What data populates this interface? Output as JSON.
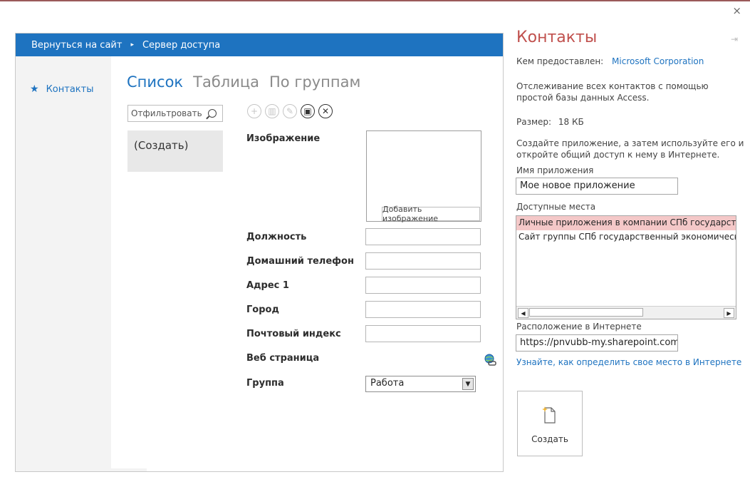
{
  "window": {
    "close_label": "×"
  },
  "preview": {
    "nav_back": "Вернуться на сайт",
    "nav_arrow": "▸",
    "nav_current": "Сервер доступа",
    "sidebar_item": "Контакты",
    "views": [
      "Список",
      "Таблица",
      "По группам"
    ],
    "filter_placeholder": "Отфильтровать",
    "list_item": "(Создать)",
    "fields": {
      "image": "Изображение",
      "add_image": "Добавить изображение",
      "position": "Должность",
      "home_phone": "Домашний телефон",
      "address": "Адрес 1",
      "city": "Город",
      "zip": "Почтовый индекс",
      "web": "Веб страница",
      "group": "Группа",
      "group_value": "Работа"
    },
    "toolbar_icons": [
      "add-icon",
      "delete-icon",
      "edit-icon",
      "save-icon",
      "cancel-icon"
    ]
  },
  "right_panel": {
    "title": "Контакты",
    "provider_label": "Кем предоставлен:",
    "provider_value": "Microsoft Corporation",
    "description": "Отслеживание всех контактов с помощью простой базы данных Access.",
    "size_label": "Размер:",
    "size_value": "18 КБ",
    "create_hint": "Создайте приложение, а затем используйте его и откройте общий доступ к нему в Интернете.",
    "app_name_label": "Имя приложения",
    "app_name_value": "Мое новое приложение",
    "places_label": "Доступные места",
    "places": [
      "Личные приложения в компании СПб государст",
      "Сайт группы СПб государственный экономически"
    ],
    "location_label": "Расположение в Интернете",
    "location_value": "https://pnvubb-my.sharepoint.com",
    "location_link": "Узнайте, как определить свое место в Интернете",
    "create_button": "Создать"
  },
  "colors": {
    "accent": "#1e73c0",
    "title": "#c0504d",
    "selected_place": "#f4c8c8"
  }
}
